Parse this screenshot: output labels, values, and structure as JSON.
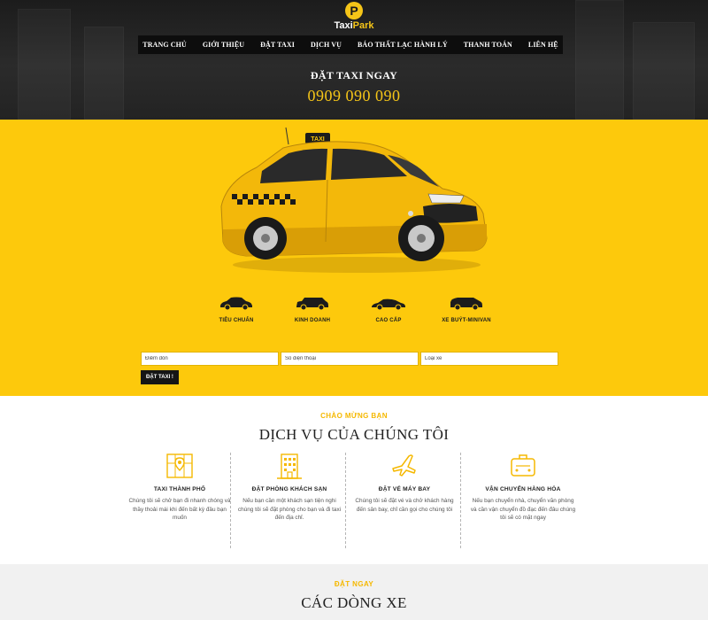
{
  "brand": {
    "logo_letter": "P",
    "name_part1": "Taxi",
    "name_part2": "Park",
    "accent": "#f5c518"
  },
  "nav": {
    "items": [
      "TRANG CHỦ",
      "GIỚI THIỆU",
      "ĐẶT TAXI",
      "DỊCH VỤ",
      "BÁO THẤT LẠC HÀNH LÝ",
      "THANH TOÁN",
      "LIÊN HỆ"
    ]
  },
  "cta": {
    "title": "ĐẶT TAXI NGAY",
    "phone": "0909 090 090"
  },
  "hero": {
    "taxi_sign": "TAXI",
    "background": "#fdc90c"
  },
  "car_types": [
    {
      "label": "TIÊU CHUẨN",
      "icon": "sedan-icon"
    },
    {
      "label": "KINH DOANH",
      "icon": "suv-icon"
    },
    {
      "label": "CAO CẤP",
      "icon": "luxury-car-icon"
    },
    {
      "label": "XE BUÝT-MINIVAN",
      "icon": "minivan-icon"
    }
  ],
  "booking": {
    "pickup_placeholder": "Điểm đón",
    "phone_placeholder": "Số điện thoại",
    "car_type_placeholder": "Loại xe",
    "submit_label": "ĐẶT TAXI !"
  },
  "services": {
    "kicker": "CHÀO MỪNG BẠN",
    "title": "DỊCH VỤ CỦA CHÚNG TÔI",
    "items": [
      {
        "icon": "city-map-icon",
        "title": "TAXI THÀNH PHỐ",
        "desc": "Chúng tôi sẽ chở bạn đi nhanh chóng và thầy thoải mái khi đến bất kỳ đâu bạn muốn"
      },
      {
        "icon": "hotel-building-icon",
        "title": "ĐẶT PHÒNG KHÁCH SẠN",
        "desc": "Nếu bạn cần một khách sạn tiện nghi chúng tôi sẽ đặt phòng cho bạn và đi taxi đến địa chỉ."
      },
      {
        "icon": "airplane-icon",
        "title": "ĐẶT VÉ MÁY BAY",
        "desc": "Chúng tôi sẽ đặt vé và chở khách hàng đến sân bay, chỉ cần gọi cho chúng tôi"
      },
      {
        "icon": "luggage-icon",
        "title": "VẬN CHUYỂN HÀNG HÓA",
        "desc": "Nếu bạn chuyển nhà, chuyển văn phòng và cần vận chuyển đồ đạc đến đâu chúng tôi sẽ có mặt ngay"
      }
    ]
  },
  "fleet": {
    "kicker": "ĐẶT NGAY",
    "title": "CÁC DÒNG XE"
  }
}
